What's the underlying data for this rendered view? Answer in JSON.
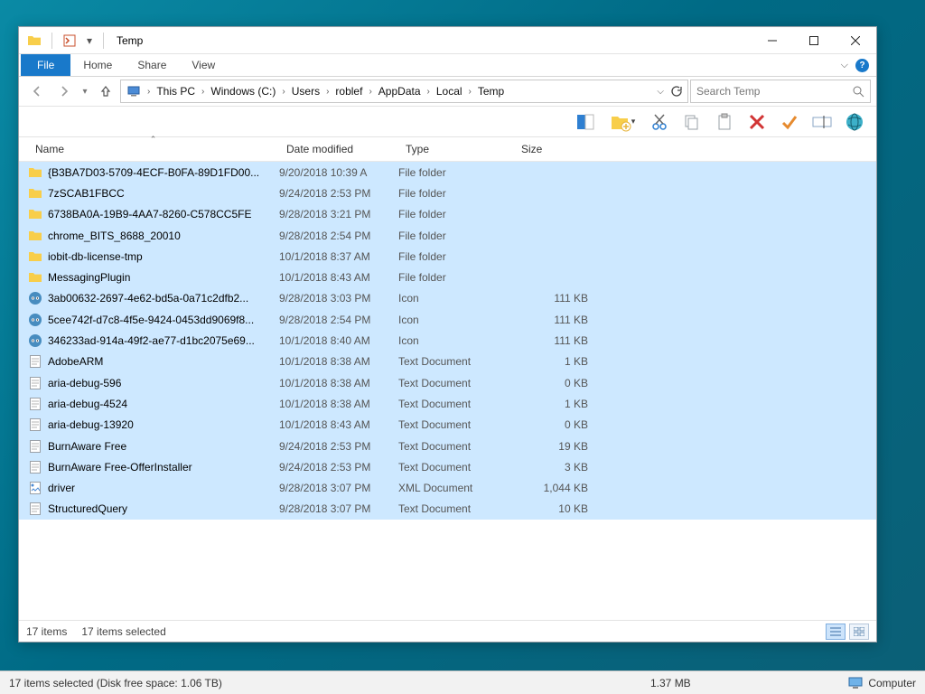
{
  "title": "Temp",
  "tabs": {
    "file": "File",
    "home": "Home",
    "share": "Share",
    "view": "View"
  },
  "breadcrumb": [
    "This PC",
    "Windows (C:)",
    "Users",
    "roblef",
    "AppData",
    "Local",
    "Temp"
  ],
  "search_placeholder": "Search Temp",
  "columns": {
    "name": "Name",
    "date": "Date modified",
    "type": "Type",
    "size": "Size"
  },
  "rows": [
    {
      "icon": "folder",
      "name": "{B3BA7D03-5709-4ECF-B0FA-89D1FD00...",
      "date": "9/20/2018 10:39 A",
      "type": "File folder",
      "size": ""
    },
    {
      "icon": "folder",
      "name": "7zSCAB1FBCC",
      "date": "9/24/2018 2:53 PM",
      "type": "File folder",
      "size": ""
    },
    {
      "icon": "folder",
      "name": "6738BA0A-19B9-4AA7-8260-C578CC5FE",
      "date": "9/28/2018 3:21 PM",
      "type": "File folder",
      "size": ""
    },
    {
      "icon": "folder",
      "name": "chrome_BITS_8688_20010",
      "date": "9/28/2018 2:54 PM",
      "type": "File folder",
      "size": ""
    },
    {
      "icon": "folder",
      "name": "iobit-db-license-tmp",
      "date": "10/1/2018 8:37 AM",
      "type": "File folder",
      "size": ""
    },
    {
      "icon": "folder",
      "name": "MessagingPlugin",
      "date": "10/1/2018 8:43 AM",
      "type": "File folder",
      "size": ""
    },
    {
      "icon": "godot",
      "name": "3ab00632-2697-4e62-bd5a-0a71c2dfb2...",
      "date": "9/28/2018 3:03 PM",
      "type": "Icon",
      "size": "111 KB"
    },
    {
      "icon": "godot",
      "name": "5cee742f-d7c8-4f5e-9424-0453dd9069f8...",
      "date": "9/28/2018 2:54 PM",
      "type": "Icon",
      "size": "111 KB"
    },
    {
      "icon": "godot",
      "name": "346233ad-914a-49f2-ae77-d1bc2075e69...",
      "date": "10/1/2018 8:40 AM",
      "type": "Icon",
      "size": "111 KB"
    },
    {
      "icon": "txt",
      "name": "AdobeARM",
      "date": "10/1/2018 8:38 AM",
      "type": "Text Document",
      "size": "1 KB"
    },
    {
      "icon": "txt",
      "name": "aria-debug-596",
      "date": "10/1/2018 8:38 AM",
      "type": "Text Document",
      "size": "0 KB"
    },
    {
      "icon": "txt",
      "name": "aria-debug-4524",
      "date": "10/1/2018 8:38 AM",
      "type": "Text Document",
      "size": "1 KB"
    },
    {
      "icon": "txt",
      "name": "aria-debug-13920",
      "date": "10/1/2018 8:43 AM",
      "type": "Text Document",
      "size": "0 KB"
    },
    {
      "icon": "txt",
      "name": "BurnAware Free",
      "date": "9/24/2018 2:53 PM",
      "type": "Text Document",
      "size": "19 KB"
    },
    {
      "icon": "txt",
      "name": "BurnAware Free-OfferInstaller",
      "date": "9/24/2018 2:53 PM",
      "type": "Text Document",
      "size": "3 KB"
    },
    {
      "icon": "xml",
      "name": "driver",
      "date": "9/28/2018 3:07 PM",
      "type": "XML Document",
      "size": "1,044 KB"
    },
    {
      "icon": "txt",
      "name": "StructuredQuery",
      "date": "9/28/2018 3:07 PM",
      "type": "Text Document",
      "size": "10 KB"
    }
  ],
  "status1": {
    "count": "17 items",
    "selected": "17 items selected"
  },
  "status2": {
    "left": "17 items selected (Disk free space: 1.06 TB)",
    "mid": "1.37 MB",
    "loc": "Computer"
  }
}
